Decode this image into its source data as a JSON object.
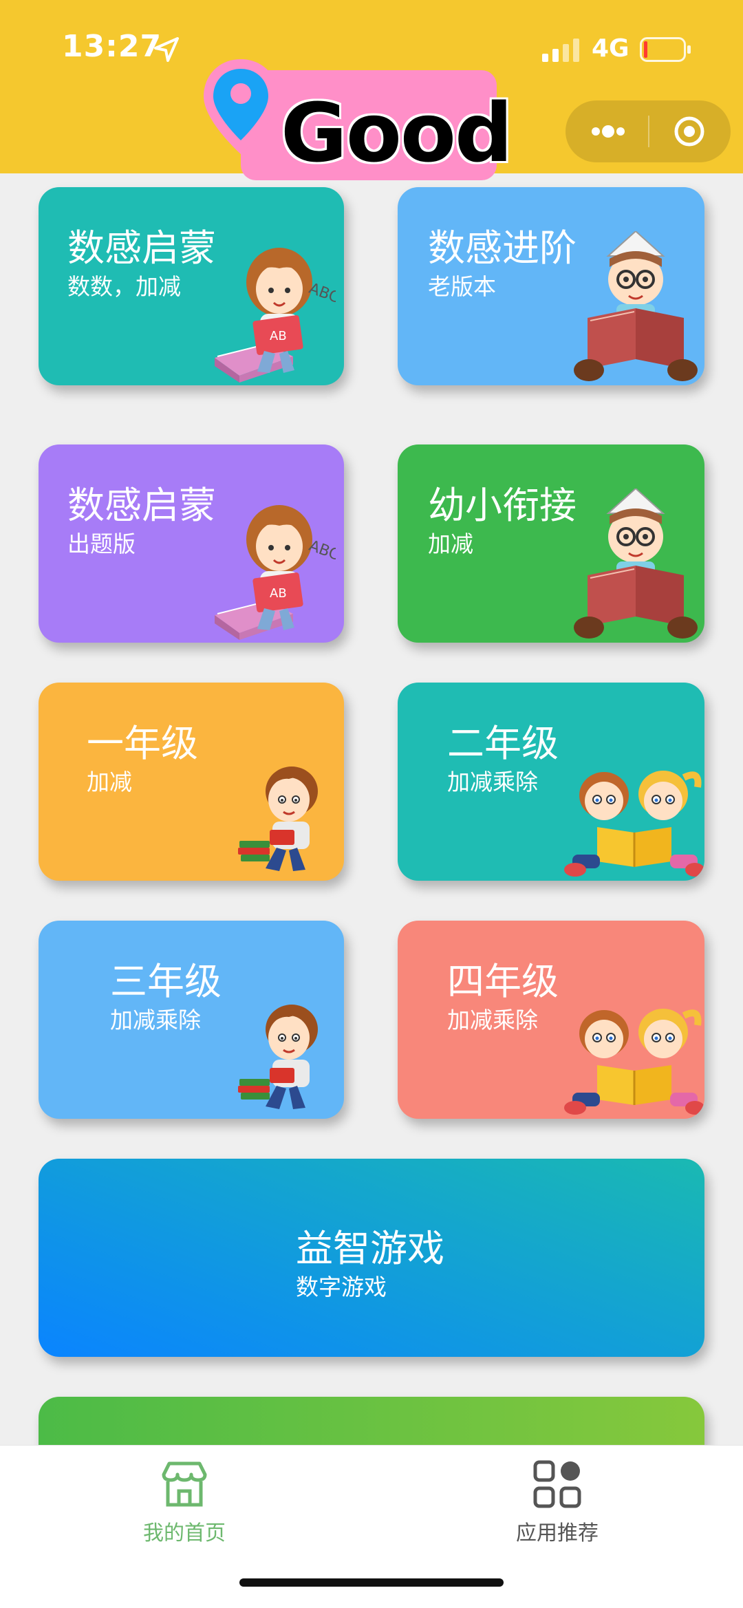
{
  "status_bar": {
    "time": "13:27",
    "network": "4G",
    "icons": [
      "location-arrow-icon",
      "signal-icon",
      "battery-low-icon"
    ]
  },
  "header": {
    "logo_text": "Good",
    "bg_color": "#f5c82e",
    "capsule_icons": [
      "more-dots-icon",
      "close-target-icon"
    ]
  },
  "cards": [
    {
      "title": "数感启蒙",
      "subtitle": "数数，加减",
      "color": "#1fbcb3",
      "illustration": "girl-reading-icon"
    },
    {
      "title": "数感进阶",
      "subtitle": "老版本",
      "color": "#62b6f7",
      "illustration": "boy-reading-book-icon"
    },
    {
      "title": "数感启蒙",
      "subtitle": "出题版",
      "color": "#a77cf7",
      "illustration": "girl-reading-icon"
    },
    {
      "title": "幼小衔接",
      "subtitle": "加减",
      "color": "#3db94e",
      "illustration": "boy-reading-book-icon"
    },
    {
      "title": "一年级",
      "subtitle": "加减",
      "color": "#fbb53f",
      "illustration": "boy-with-books-icon"
    },
    {
      "title": "二年级",
      "subtitle": "加减乘除",
      "color": "#1fbcb3",
      "illustration": "two-kids-reading-icon"
    },
    {
      "title": "三年级",
      "subtitle": "加减乘除",
      "color": "#62b6f7",
      "illustration": "boy-with-books-icon"
    },
    {
      "title": "四年级",
      "subtitle": "加减乘除",
      "color": "#f8877a",
      "illustration": "two-kids-reading-icon"
    }
  ],
  "wide_card": {
    "title": "益智游戏",
    "subtitle": "数字游戏",
    "color_from": "#0a84ff",
    "color_to": "#1ab9b2"
  },
  "partial_card": {
    "color_from": "#4cbb47",
    "color_to": "#86c83c"
  },
  "tabbar": {
    "tabs": [
      {
        "label": "我的首页",
        "icon": "home-store-icon",
        "active": true,
        "color": "#6db86e"
      },
      {
        "label": "应用推荐",
        "icon": "apps-grid-icon",
        "active": false,
        "color": "#555555"
      }
    ]
  }
}
